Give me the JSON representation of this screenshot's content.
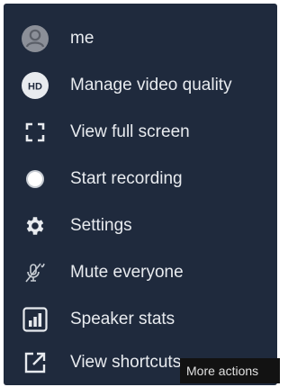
{
  "menu": {
    "items": [
      {
        "label": "me",
        "icon": "avatar-icon"
      },
      {
        "label": "Manage video quality",
        "icon": "hd-icon",
        "badge": "HD"
      },
      {
        "label": "View full screen",
        "icon": "fullscreen-icon"
      },
      {
        "label": "Start recording",
        "icon": "record-icon"
      },
      {
        "label": "Settings",
        "icon": "gear-icon"
      },
      {
        "label": "Mute everyone",
        "icon": "mic-off-icon"
      },
      {
        "label": "Speaker stats",
        "icon": "stats-icon"
      },
      {
        "label": "View shortcuts",
        "icon": "external-link-icon"
      }
    ]
  },
  "tooltip": {
    "text": "More actions"
  },
  "colors": {
    "background": "#1f2a3d",
    "text": "#e8ebef",
    "avatar": "#8b8f98",
    "hd_badge": "#e8ebef"
  }
}
